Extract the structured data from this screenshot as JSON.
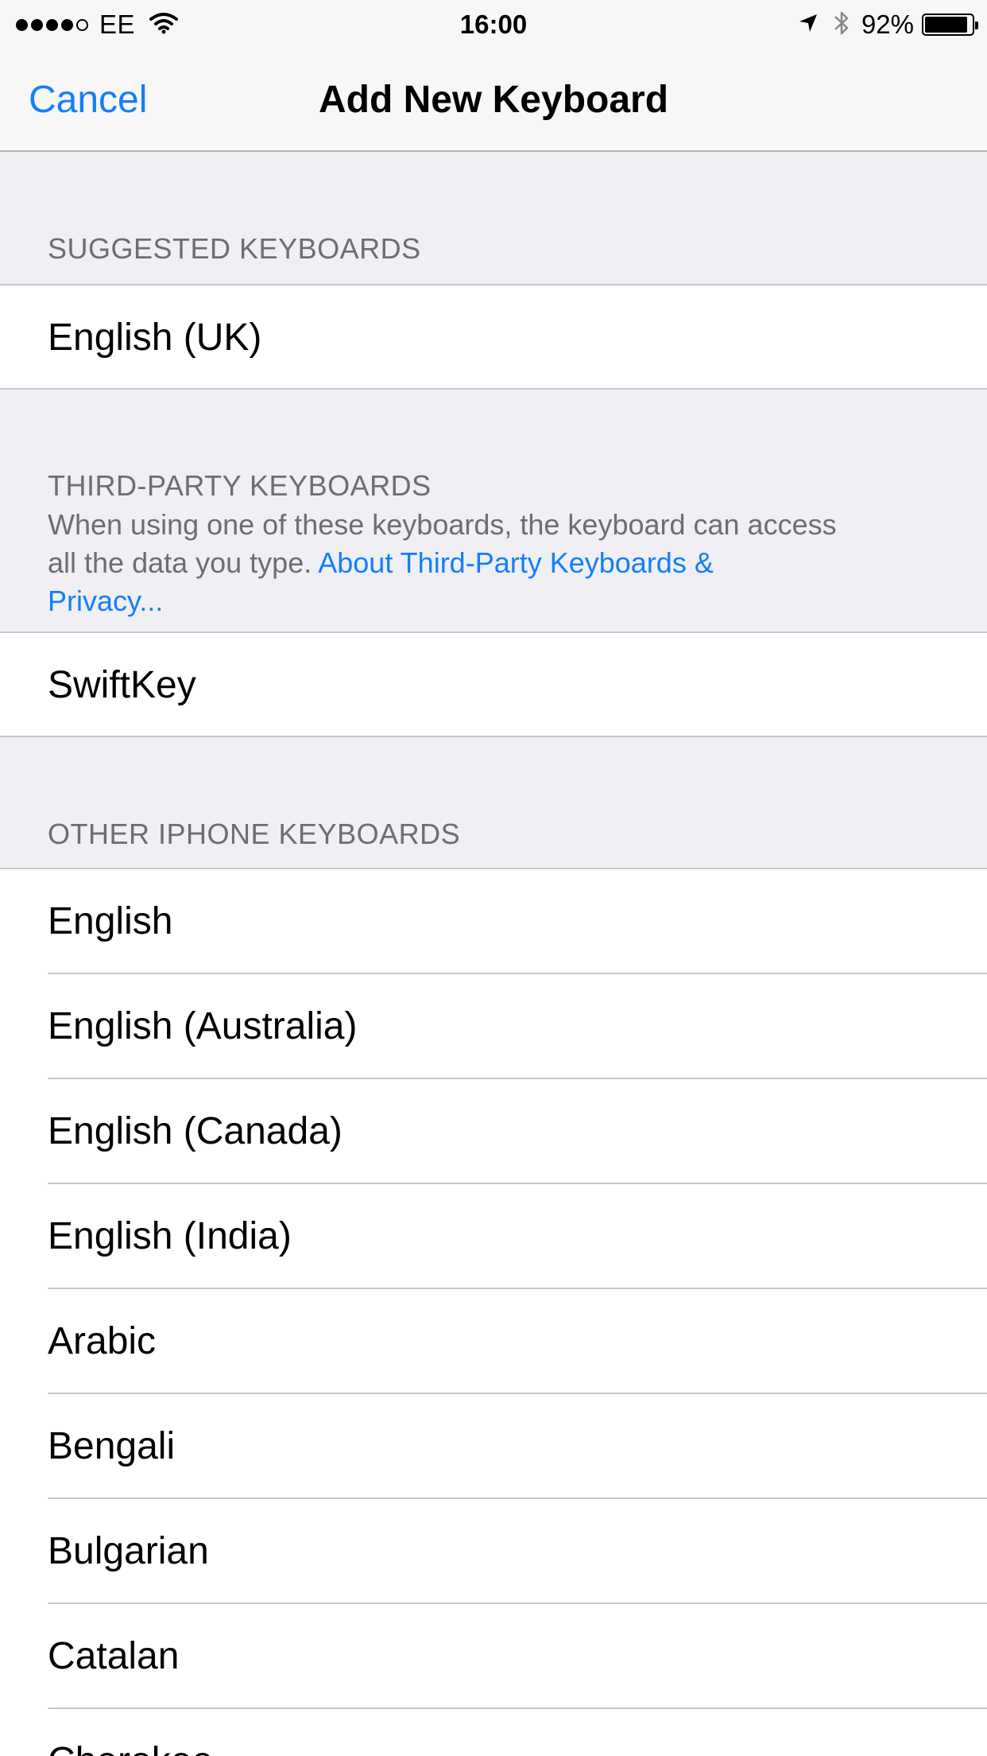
{
  "status_bar": {
    "carrier": "EE",
    "signal_bars_filled": 4,
    "signal_bars_total": 5,
    "time": "16:00",
    "battery_percent": "92%",
    "battery_level": 0.92,
    "icons": [
      "wifi-icon",
      "location-arrow-icon",
      "bluetooth-icon",
      "battery-icon"
    ]
  },
  "navbar": {
    "cancel_label": "Cancel",
    "title": "Add New Keyboard"
  },
  "sections": {
    "suggested": {
      "header": "SUGGESTED KEYBOARDS",
      "items": [
        "English (UK)"
      ]
    },
    "third_party": {
      "header": "THIRD-PARTY KEYBOARDS",
      "description": "When using one of these keyboards, the keyboard can access all the data you type.",
      "link_line1": "About Third-Party Keyboards &",
      "link_line2": "Privacy...",
      "description_line1": "When using one of these keyboards, the keyboard can access",
      "description_line2": "all the data you type.",
      "items": [
        "SwiftKey"
      ]
    },
    "other": {
      "header": "OTHER IPHONE KEYBOARDS",
      "items": [
        "English",
        "English (Australia)",
        "English (Canada)",
        "English (India)",
        "Arabic",
        "Bengali",
        "Bulgarian",
        "Catalan",
        "Cherokee"
      ]
    }
  },
  "colors": {
    "accent": "#147efb",
    "group_background": "#efeff4",
    "section_text": "#6d6d72",
    "separator": "#c8c7cc",
    "navbar_background": "#f7f7f7"
  }
}
